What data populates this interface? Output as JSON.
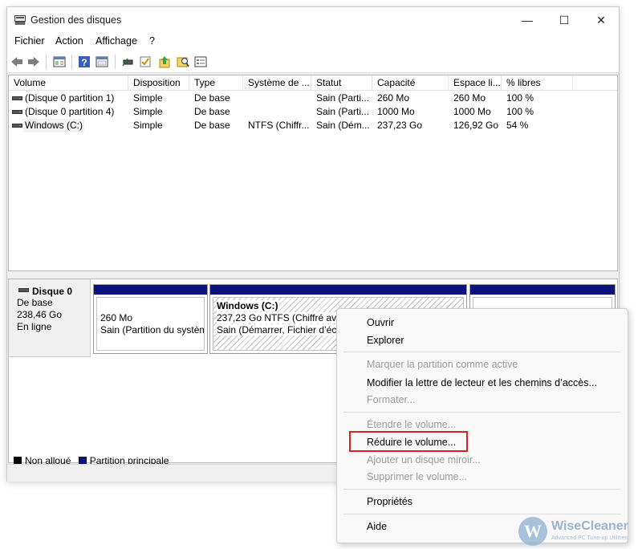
{
  "window": {
    "title": "Gestion des disques",
    "min_glyph": "—",
    "max_glyph": "☐",
    "close_glyph": "✕"
  },
  "menubar": [
    "Fichier",
    "Action",
    "Affichage",
    "?"
  ],
  "toolbar_icons": [
    "back-arrow-icon",
    "forward-arrow-icon",
    "console-tree-icon",
    "help-icon",
    "properties-icon",
    "connect-disk-icon",
    "check-icon",
    "up-arrow-icon",
    "search-icon",
    "list-view-icon"
  ],
  "volumes": {
    "columns": [
      "Volume",
      "Disposition",
      "Type",
      "Système de ...",
      "Statut",
      "Capacité",
      "Espace li...",
      "% libres"
    ],
    "rows": [
      {
        "volume": "(Disque 0 partition 1)",
        "disposition": "Simple",
        "type": "De base",
        "fs": "",
        "statut": "Sain (Parti...",
        "capacite": "260 Mo",
        "espace": "260 Mo",
        "libres": "100 %"
      },
      {
        "volume": "(Disque 0 partition 4)",
        "disposition": "Simple",
        "type": "De base",
        "fs": "",
        "statut": "Sain (Parti...",
        "capacite": "1000 Mo",
        "espace": "1000 Mo",
        "libres": "100 %"
      },
      {
        "volume": "Windows (C:)",
        "disposition": "Simple",
        "type": "De base",
        "fs": "NTFS (Chiffr...",
        "statut": "Sain (Dém...",
        "capacite": "237,23 Go",
        "espace": "126,92 Go",
        "libres": "54 %"
      }
    ]
  },
  "disk": {
    "name": "Disque 0",
    "type": "De base",
    "size": "238,46 Go",
    "state": "En ligne",
    "partitions": [
      {
        "size": "260 Mo",
        "status": "Sain (Partition du systèm"
      },
      {
        "name": "Windows  (C:)",
        "size": "237,23 Go NTFS (Chiffré avec",
        "status": "Sain (Démarrer, Fichier d’écha"
      },
      {
        "size": "",
        "status": ""
      }
    ]
  },
  "legend": {
    "unallocated": "Non alloué",
    "primary": "Partition principale",
    "unallocated_color": "#000000",
    "primary_color": "#0c1280"
  },
  "context_menu": {
    "items": [
      {
        "label": "Ouvrir",
        "enabled": true
      },
      {
        "label": "Explorer",
        "enabled": true
      },
      {
        "label": "Marquer la partition comme active",
        "enabled": false
      },
      {
        "label": "Modifier la lettre de lecteur et les chemins d’accès...",
        "enabled": true
      },
      {
        "label": "Formater...",
        "enabled": false
      },
      {
        "label": "Étendre le volume...",
        "enabled": false
      },
      {
        "label": "Réduire le volume...",
        "enabled": true,
        "highlighted": true
      },
      {
        "label": "Ajouter un disque miroir...",
        "enabled": false
      },
      {
        "label": "Supprimer le volume...",
        "enabled": false
      },
      {
        "label": "Propriétés",
        "enabled": true
      },
      {
        "label": "Aide",
        "enabled": true
      }
    ]
  },
  "watermark": {
    "letter": "W",
    "brand": "WiseCleaner",
    "tagline": "Advanced PC Tune-up Utilities"
  }
}
